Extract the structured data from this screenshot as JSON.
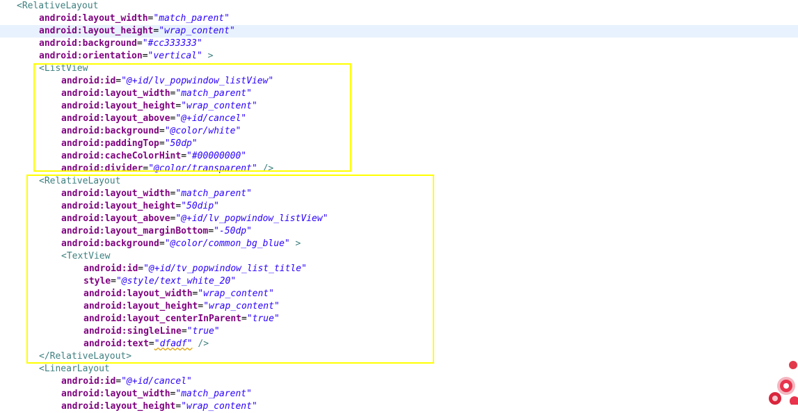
{
  "lines": [
    {
      "type": "open",
      "tag": "<RelativeLayout"
    },
    {
      "type": "attr",
      "name": "android:layout_width",
      "value": "\"match_parent\""
    },
    {
      "type": "attr",
      "name": "android:layout_height",
      "value": "\"wrap_content\"",
      "current": true
    },
    {
      "type": "attr",
      "name": "android:background",
      "value": "\"#cc333333\""
    },
    {
      "type": "attr",
      "name": "android:orientation",
      "value": "\"vertical\"",
      "close": " >"
    },
    {
      "type": "open",
      "tag": "<ListView"
    },
    {
      "type": "attr",
      "name": "android:id",
      "value": "\"@+id/lv_popwindow_listView\""
    },
    {
      "type": "attr",
      "name": "android:layout_width",
      "value": "\"match_parent\""
    },
    {
      "type": "attr",
      "name": "android:layout_height",
      "value": "\"wrap_content\""
    },
    {
      "type": "attr",
      "name": "android:layout_above",
      "value": "\"@+id/cancel\""
    },
    {
      "type": "attr",
      "name": "android:background",
      "value": "\"@color/white\""
    },
    {
      "type": "attr",
      "name": "android:paddingTop",
      "value": "\"50dp\""
    },
    {
      "type": "attr",
      "name": "android:cacheColorHint",
      "value": "\"#00000000\""
    },
    {
      "type": "attr",
      "name": "android:divider",
      "value": "\"@color/transparent\"",
      "close": " />"
    },
    {
      "type": "open",
      "tag": "<RelativeLayout"
    },
    {
      "type": "attr",
      "name": "android:layout_width",
      "value": "\"match_parent\""
    },
    {
      "type": "attr",
      "name": "android:layout_height",
      "value": "\"50dip\""
    },
    {
      "type": "attr",
      "name": "android:layout_above",
      "value": "\"@+id/lv_popwindow_listView\""
    },
    {
      "type": "attr",
      "name": "android:layout_marginBottom",
      "value": "\"-50dp\""
    },
    {
      "type": "attr",
      "name": "android:background",
      "value": "\"@color/common_bg_blue\"",
      "close": " >"
    },
    {
      "type": "open",
      "tag": "<TextView"
    },
    {
      "type": "attr",
      "name": "android:id",
      "value": "\"@+id/tv_popwindow_list_title\""
    },
    {
      "type": "attr",
      "name": "style",
      "value": "\"@style/text_white_20\""
    },
    {
      "type": "attr",
      "name": "android:layout_width",
      "value": "\"wrap_content\""
    },
    {
      "type": "attr",
      "name": "android:layout_height",
      "value": "\"wrap_content\""
    },
    {
      "type": "attr",
      "name": "android:layout_centerInParent",
      "value": "\"true\""
    },
    {
      "type": "attr",
      "name": "android:singleLine",
      "value": "\"true\""
    },
    {
      "type": "attr",
      "name": "android:text",
      "value": "\"dfadf\"",
      "close": " />",
      "squiggle": true
    },
    {
      "type": "open",
      "tag": "</RelativeLayout>"
    },
    {
      "type": "open",
      "tag": "<LinearLayout"
    },
    {
      "type": "attr",
      "name": "android:id",
      "value": "\"@+id/cancel\""
    },
    {
      "type": "attr",
      "name": "android:layout_width",
      "value": "\"match_parent\""
    },
    {
      "type": "attr",
      "name": "android:layout_height",
      "value": "\"wrap_content\""
    }
  ],
  "colors": {
    "tag": "#3f7f7f",
    "attribute": "#7f007f",
    "value": "#2a00ff",
    "current_line": "#e8f2fe",
    "highlight_box": "#ffff00"
  }
}
